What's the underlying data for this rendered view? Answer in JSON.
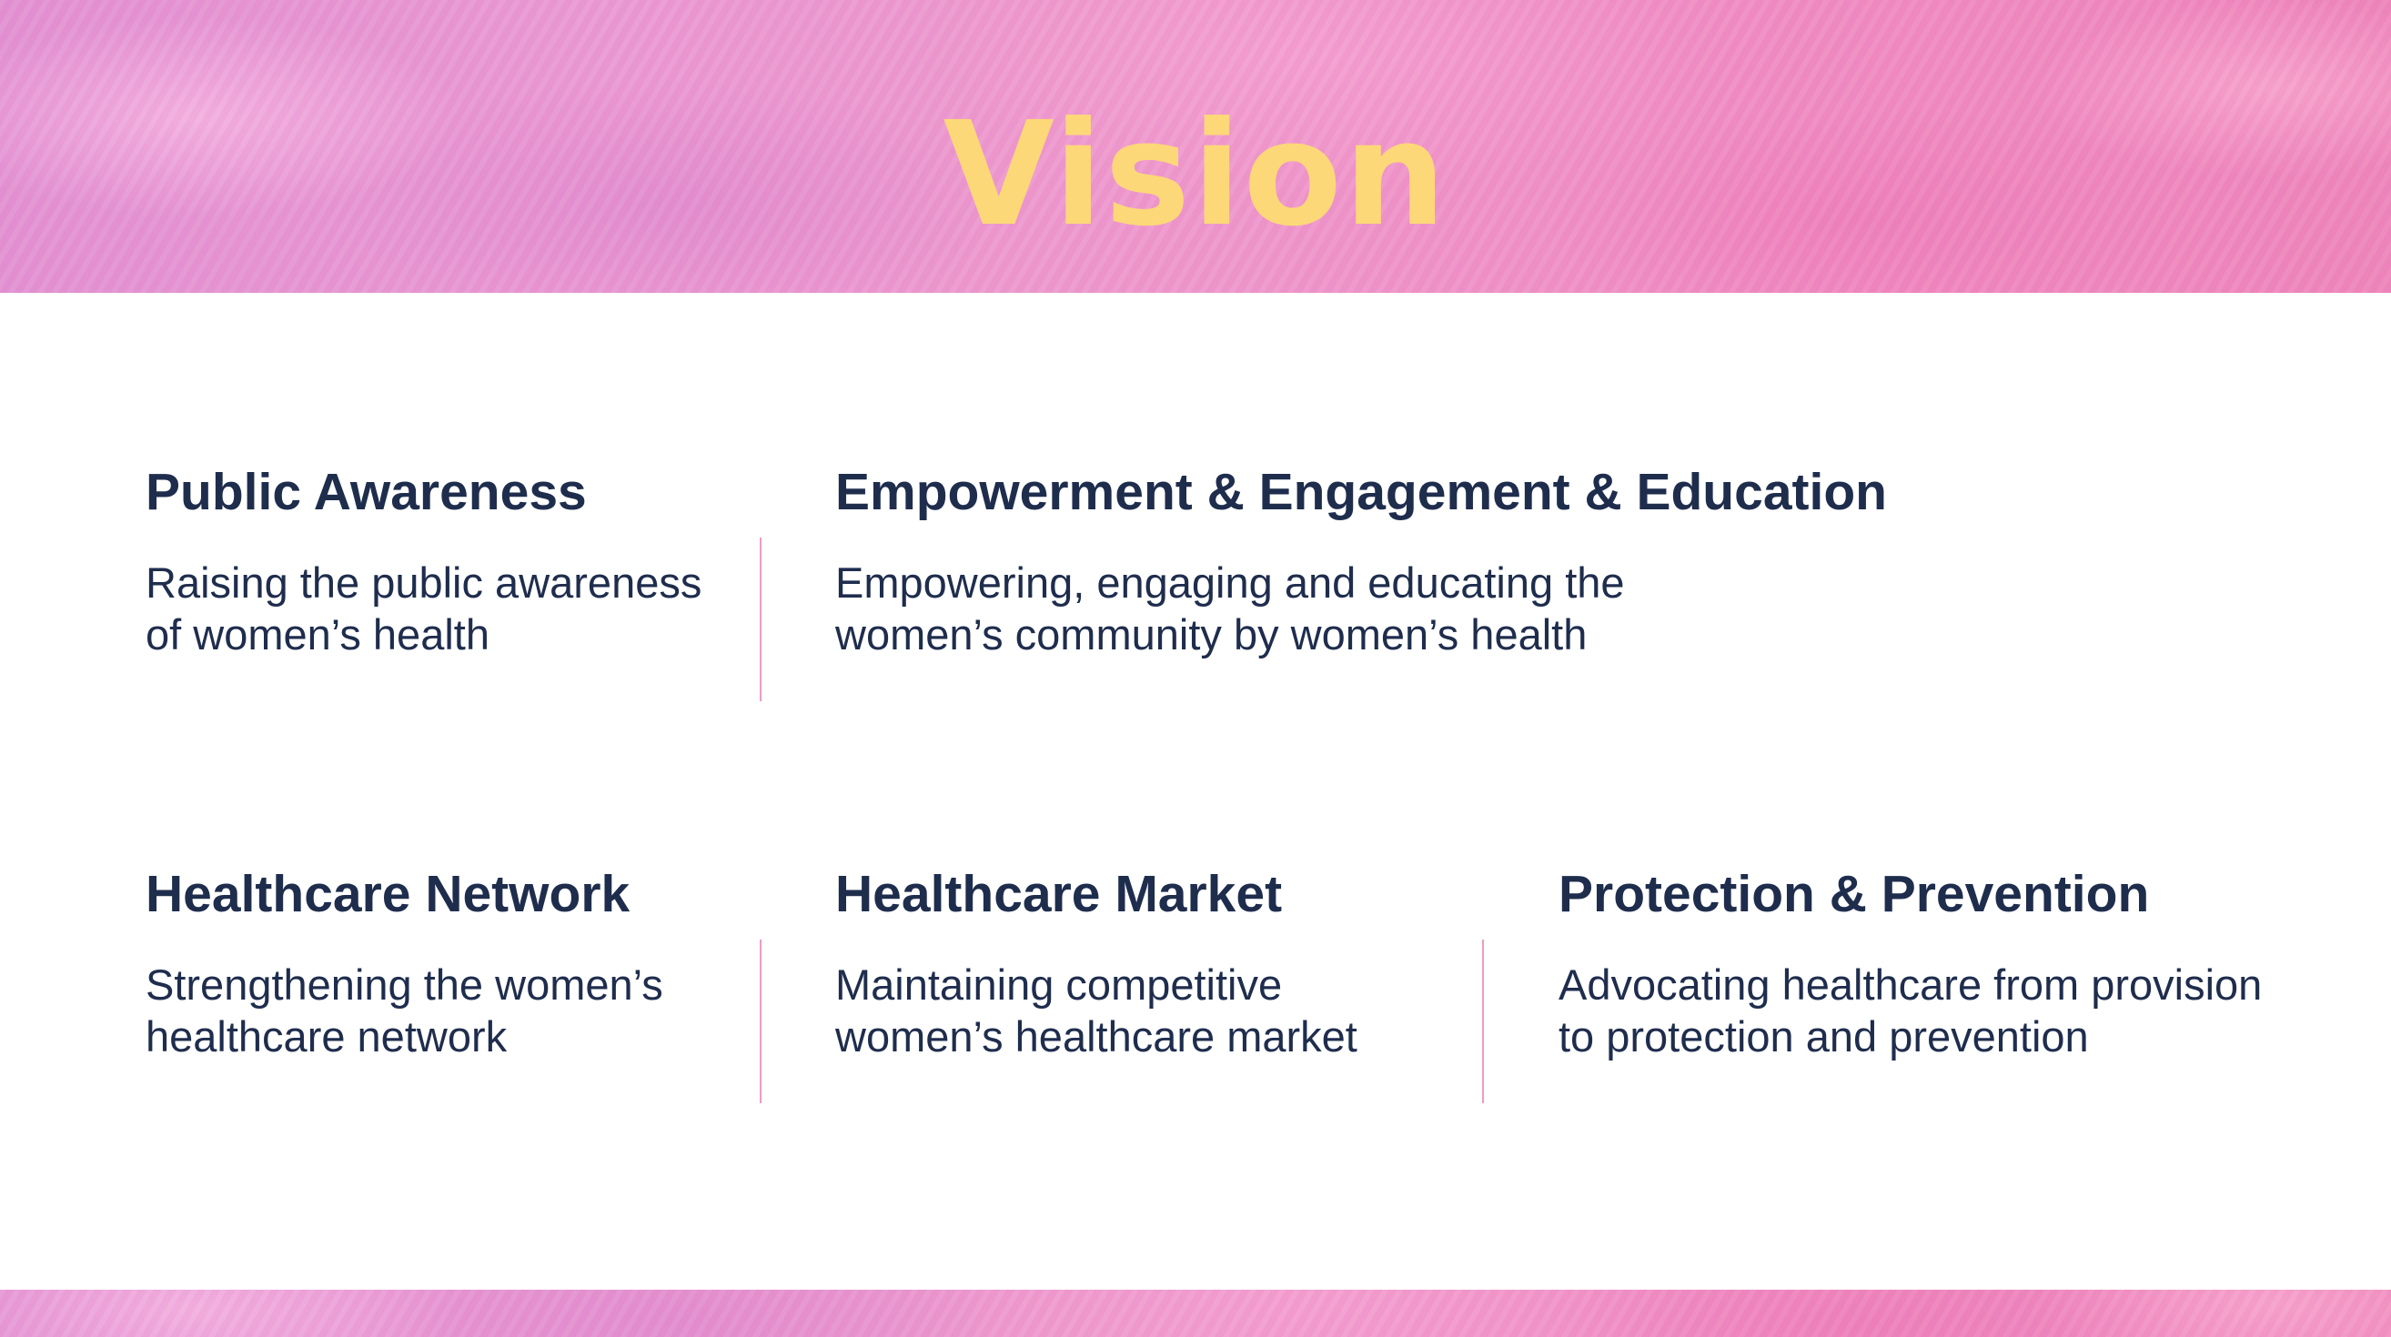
{
  "title": "Vision",
  "colors": {
    "title": "#fcd878",
    "text": "#1f2d4d",
    "divider": "#ee9cc4",
    "banner": "#ec94c8"
  },
  "items": [
    {
      "heading": "Public Awareness",
      "desc_line1": "Raising the public awareness",
      "desc_line2": "of women’s health"
    },
    {
      "heading": "Empowerment & Engagement & Education",
      "desc_line1": "Empowering, engaging and educating the",
      "desc_line2": "women’s community by women’s health"
    },
    {
      "heading": "Healthcare Network",
      "desc_line1": "Strengthening the women’s",
      "desc_line2": "healthcare network"
    },
    {
      "heading": "Healthcare Market",
      "desc_line1": "Maintaining competitive",
      "desc_line2": "women’s healthcare market"
    },
    {
      "heading": "Protection & Prevention",
      "desc_line1": "Advocating healthcare from provision",
      "desc_line2": "to protection and prevention"
    }
  ]
}
